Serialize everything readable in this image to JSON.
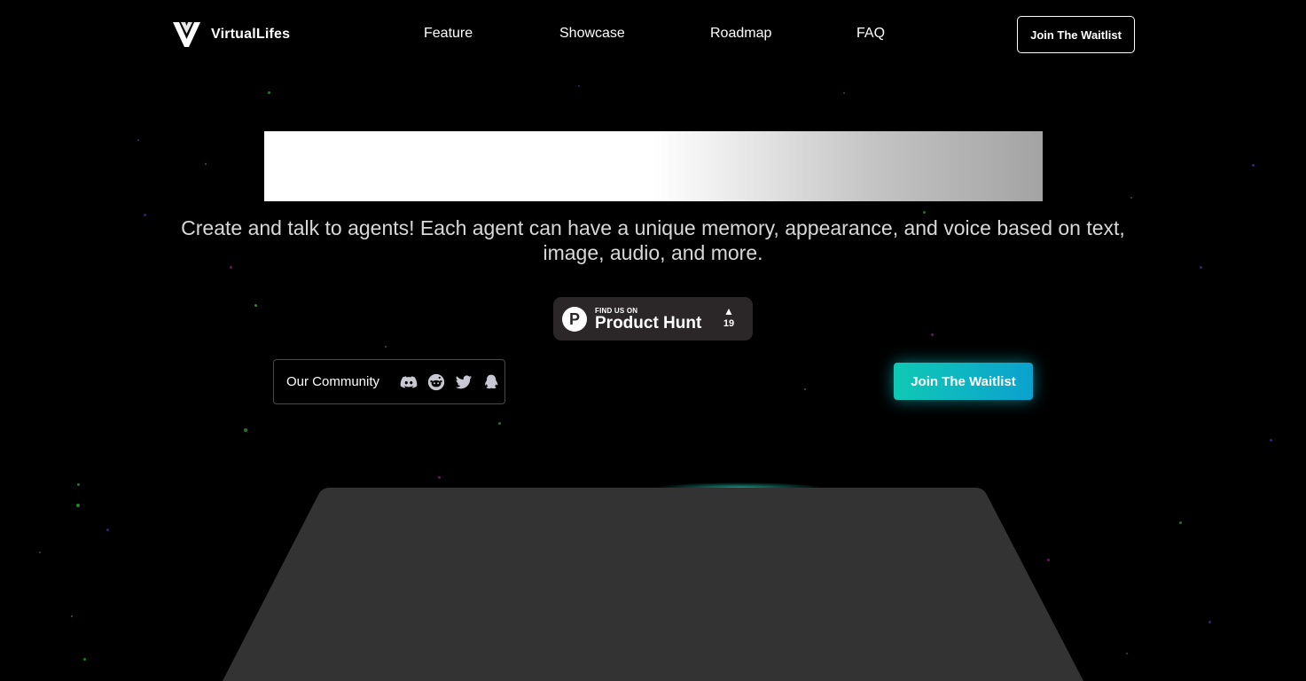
{
  "nav": {
    "brand": "VirtualLifes",
    "links": [
      "Feature",
      "Showcase",
      "Roadmap",
      "FAQ"
    ],
    "cta_label": "Join The Waitlist"
  },
  "hero": {
    "tagline": "Create and talk to agents! Each agent can have a unique memory, appearance, and voice based on text, image, audio, and more."
  },
  "product_hunt": {
    "small_text": "FIND US ON",
    "big_text": "Product Hunt",
    "vote_count": "19"
  },
  "community": {
    "label": "Our Community",
    "icons": [
      "discord-icon",
      "reddit-icon",
      "twitter-icon",
      "qq-icon"
    ]
  },
  "cta": {
    "label": "Join The Waitlist"
  },
  "colors": {
    "background": "#000000",
    "accent_start": "#0fc9b4",
    "accent_end": "#0ba1cf",
    "stage": "#333333",
    "badge": "#2b2729"
  }
}
